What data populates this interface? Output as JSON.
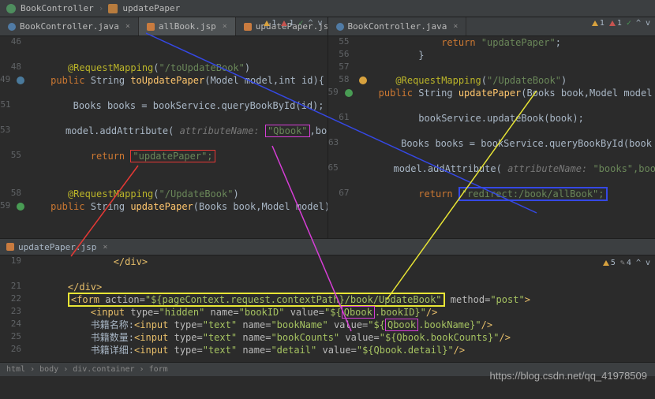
{
  "breadcrumb_top": {
    "class": "BookController",
    "method": "updatePaper"
  },
  "tabs_left": [
    {
      "label": "BookController.java",
      "type": "java"
    },
    {
      "label": "allBook.jsp",
      "type": "jsp",
      "active": true
    },
    {
      "label": "updatePaper.jsp",
      "type": "jsp"
    }
  ],
  "tabs_right": [
    {
      "label": "BookController.java",
      "type": "java"
    }
  ],
  "left_status": {
    "warn": "1",
    "err": "1"
  },
  "right_status": {
    "warn": "1",
    "err": "1"
  },
  "bottom_status": {
    "warn": "5",
    "up": "4"
  },
  "left_gutter": [
    "46",
    "",
    "48",
    "49",
    "",
    "51",
    "",
    "53",
    "",
    "55",
    "",
    "",
    "58",
    "59"
  ],
  "right_gutter": [
    "55",
    "56",
    "57",
    "58",
    "59",
    "",
    "61",
    "",
    "63",
    "",
    "65",
    "",
    "67"
  ],
  "left_code": {
    "mapping1": "@RequestMapping",
    "path1": "\"/toUpdateBook\"",
    "sig1_kw": "public",
    "sig1_ret": "String",
    "sig1_name": "toUpdatePaper",
    "sig1_params": "(Model model,int id){",
    "line51": "Books books = bookService.queryBookById(id);",
    "l53a": "model.addAttribute(",
    "l53hint": "attributeName:",
    "l53qbook": "\"Qbook\"",
    "l53b": ",books);",
    "ret_kw": "return",
    "ret_val": "\"updatePaper\";",
    "mapping2": "@RequestMapping",
    "path2": "\"/UpdateBook\"",
    "sig2": "public String updatePaper(Books book,Model model){"
  },
  "right_code": {
    "ret55": "return \"updatePaper\";",
    "close": "}",
    "mapping": "@RequestMapping",
    "path": "\"/UpdateBook\"",
    "sig": "public String updatePaper(Books book,Model model",
    "l61": "bookService.updateBook(book);",
    "l63": "Books books = bookService.queryBookById(book",
    "l65a": "model.addAttribute(",
    "l65hint": "attributeName:",
    "l65b": "\"books\",boo",
    "ret67kw": "return",
    "ret67val": "\"redirect:/book/allBook\";"
  },
  "bottom_tab": "updatePaper.jsp",
  "bottom_gutter": [
    "19",
    "",
    "21",
    "22",
    "23",
    "24",
    "25",
    "26",
    ""
  ],
  "bottom_code": {
    "l19": "</div>",
    "l21": "</div>",
    "form_open_a": "<form action=",
    "form_action": "\"${pageContext.request.contextPath}/book/UpdateBook\"",
    "form_open_b": " method=\"post\">",
    "l23a": "<input type=\"hidden\" name=\"bookID\" value=\"${",
    "l23q": "Qbook",
    "l23b": ".bookID}\"/>",
    "l24label": "书籍名称:",
    "l24a": "<input type=\"text\" name=\"bookName\" value=\"${",
    "l24q": "Qbook",
    "l24b": ".bookName}\"/>",
    "l25label": "书籍数量:",
    "l25": "<input type=\"text\" name=\"bookCounts\" value=\"${Qbook.bookCounts}\"/>",
    "l26label": "书籍详细:",
    "l26": "<input type=\"text\" name=\"detail\" value=\"${Qbook.detail}\"/>"
  },
  "breadcrumb_bottom": [
    "html",
    "body",
    "div.container",
    "form"
  ],
  "watermark": "https://blog.csdn.net/qq_41978509"
}
